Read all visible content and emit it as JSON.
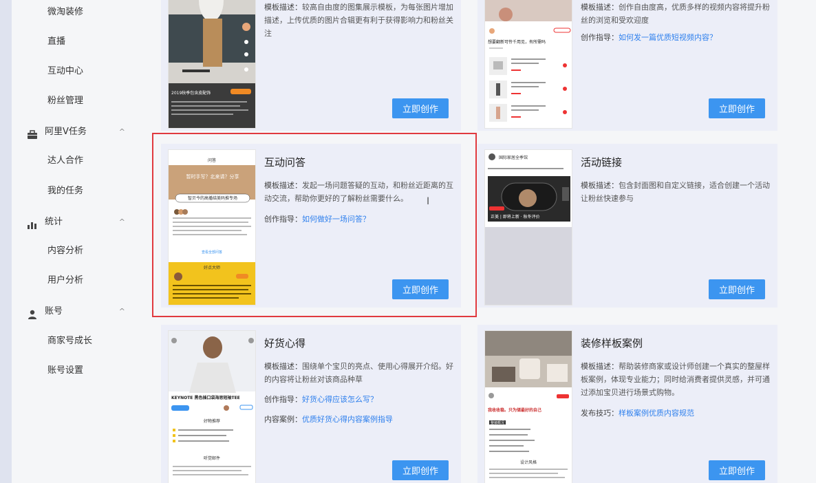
{
  "sidebar": {
    "items": [
      {
        "label": "微淘装修",
        "type": "sub"
      },
      {
        "label": "直播",
        "type": "sub"
      },
      {
        "label": "互动中心",
        "type": "sub"
      },
      {
        "label": "粉丝管理",
        "type": "sub"
      },
      {
        "label": "阿里V任务",
        "type": "group",
        "icon": "briefcase-icon"
      },
      {
        "label": "达人合作",
        "type": "sub"
      },
      {
        "label": "我的任务",
        "type": "sub"
      },
      {
        "label": "统计",
        "type": "group",
        "icon": "bar-chart-icon"
      },
      {
        "label": "内容分析",
        "type": "sub"
      },
      {
        "label": "用户分析",
        "type": "sub"
      },
      {
        "label": "账号",
        "type": "group",
        "icon": "user-icon"
      },
      {
        "label": "商家号成长",
        "type": "sub"
      },
      {
        "label": "账号设置",
        "type": "sub"
      }
    ],
    "chevron": "^"
  },
  "cards": {
    "top_left": {
      "desc_label": "模板描述：",
      "desc_text": "较高自由度的图集展示模板，为每张图片增加描述，上传优质的图片合辑更有利于获得影响力和粉丝关注",
      "button": "立即创作"
    },
    "top_right": {
      "desc_label": "模板描述：",
      "desc_text": "创作自由度高，优质多样的视频内容将提升粉丝的浏览和受欢迎度",
      "guide_label": "创作指导：",
      "guide_link": "如何发一篇优质短视频内容？",
      "button": "立即创作"
    },
    "qa": {
      "title": "互动问答",
      "desc_label": "模板描述：",
      "desc_text": "发起一场问题答疑的互动，和粉丝近距离的互动交流，帮助你更好的了解粉丝需要什么。",
      "guide_label": "创作指导：",
      "guide_link": "如何做好一场问答？",
      "button": "立即创作"
    },
    "activity": {
      "title": "活动链接",
      "desc_label": "模板描述：",
      "desc_text": "包含封面图和自定义链接，适合创建一个活动让粉丝快速参与",
      "button": "立即创作"
    },
    "goods": {
      "title": "好货心得",
      "desc_label": "模板描述：",
      "desc_text": "围绕单个宝贝的亮点、使用心得展开介绍。好的内容将让粉丝对该商品种草",
      "guide_label": "创作指导：",
      "guide_link": "好货心得应该怎么写？",
      "case_label": "内容案例：",
      "case_link": "优质好货心得内容案例指导",
      "button": "立即创作"
    },
    "decor": {
      "title": "装修样板案例",
      "desc_label": "模板描述：",
      "desc_text": "帮助装修商家或设计师创建一个真实的整屋样板案例，体现专业能力；同时给消费者提供灵感，并可通过添加宝贝进行场景式购物。",
      "tips_label": "发布技巧：",
      "tips_link": "样板案例优质内容规范",
      "button": "立即创作"
    }
  },
  "thumbs": {
    "qa_header": "问答",
    "qa_banner": "暂时手写？北来请？分享",
    "qa_banner2": "智贝今的高播结美码推专场",
    "qa_more": "查看全部问答",
    "qa_yellow_title": "好点大师",
    "activity_title": "国际家居全季馆",
    "activity_caption": "正美 | 即将上新 · 秋冬评价",
    "goods_brand": "KEYNOTE 黑色插口袋海思短袖TEE",
    "goods_section": "好物推荐",
    "goods_section2": "听觉邮件",
    "decor_headline": "我收收稳。只为储最好的自己",
    "decor_section": "整装概况",
    "decor_section2": "设计风格",
    "tl_caption": "2019秋季包含皮配饰",
    "tr_title": "想要翻新可怜千用见，有所需吗"
  },
  "colors": {
    "accent": "#3c95f0",
    "link": "#2f80ed",
    "highlight": "#e0393e"
  }
}
